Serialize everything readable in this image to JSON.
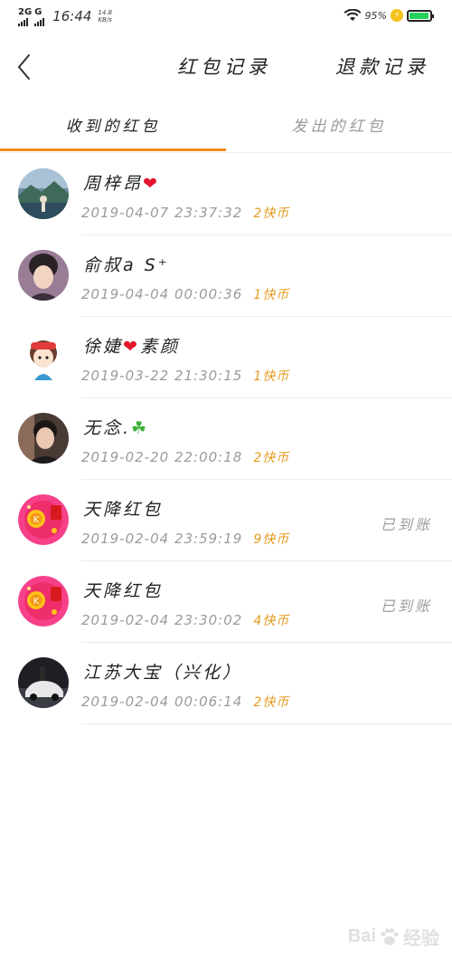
{
  "status_bar": {
    "signal1": "2G",
    "signal2": "G",
    "time": "16:44",
    "speed_top": "14.8",
    "speed_bottom": "KB/s",
    "battery_pct": "95%",
    "battery_level": 0.95
  },
  "header": {
    "title": "红包记录",
    "refund_link": "退款记录"
  },
  "tabs": [
    {
      "label": "收到的红包",
      "active": true
    },
    {
      "label": "发出的红包",
      "active": false
    }
  ],
  "records": [
    {
      "name": "周梓昂",
      "emoji": "❤",
      "time": "2019-04-07  23:37:32",
      "amount": "2快币",
      "status": ""
    },
    {
      "name": "俞叔a  S⁺",
      "emoji": "",
      "time": "2019-04-04  00:00:36",
      "amount": "1快币",
      "status": ""
    },
    {
      "name": "徐婕",
      "emoji": "❤",
      "name_suffix": "素颜",
      "time": "2019-03-22  21:30:15",
      "amount": "1快币",
      "status": ""
    },
    {
      "name": "无念.",
      "emoji": "☘",
      "time": "2019-02-20  22:00:18",
      "amount": "2快币",
      "status": ""
    },
    {
      "name": "天降红包",
      "emoji": "",
      "time": "2019-02-04  23:59:19",
      "amount": "9快币",
      "status": "已到账"
    },
    {
      "name": "天降红包",
      "emoji": "",
      "time": "2019-02-04  23:30:02",
      "amount": "4快币",
      "status": "已到账"
    },
    {
      "name": "江苏大宝（兴化）",
      "emoji": "",
      "time": "2019-02-04  00:06:14",
      "amount": "2快币",
      "status": ""
    }
  ],
  "watermark": {
    "text": "Bai",
    "text2": "经验"
  },
  "colors": {
    "accent": "#f08a14",
    "amount": "#e59b1e",
    "muted": "#9b9b9b"
  }
}
